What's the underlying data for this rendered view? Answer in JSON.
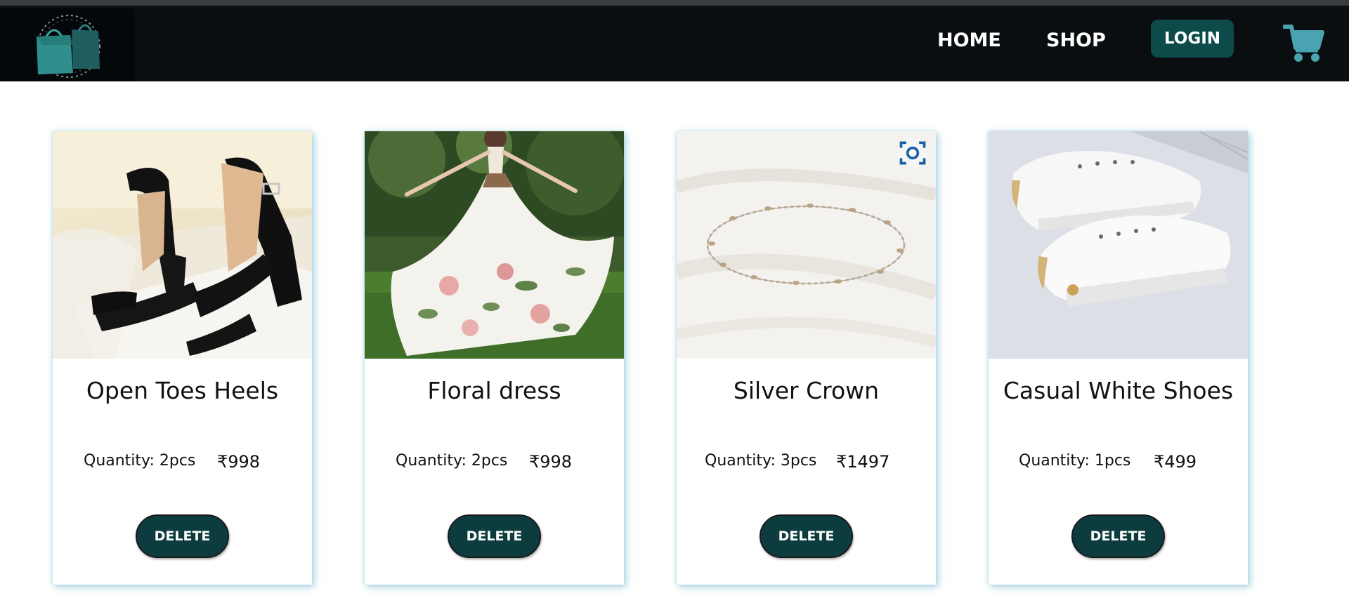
{
  "nav": {
    "logo_alt": "shopping bags logo",
    "home_label": "HOME",
    "shop_label": "SHOP",
    "login_label": "LOGIN",
    "cart_icon": "cart-icon"
  },
  "cart_items": [
    {
      "name": "Open Toes Heels",
      "quantity": "Quantity: 2pcs",
      "price": "₹998",
      "delete_label": "DELETE"
    },
    {
      "name": "Floral dress",
      "quantity": "Quantity: 2pcs",
      "price": "₹998",
      "delete_label": "DELETE"
    },
    {
      "name": "Silver Crown",
      "quantity": "Quantity: 3pcs",
      "price": "₹1497",
      "delete_label": "DELETE"
    },
    {
      "name": "Casual White Shoes",
      "quantity": "Quantity: 1pcs",
      "price": "₹499",
      "delete_label": "DELETE"
    }
  ],
  "colors": {
    "navbar_bg": "#0a0e10",
    "login_bg": "#0d4a4a",
    "delete_bg": "#0c3c3e",
    "cart_icon": "#4aa3b0",
    "card_shadow": "#5aaac8"
  }
}
